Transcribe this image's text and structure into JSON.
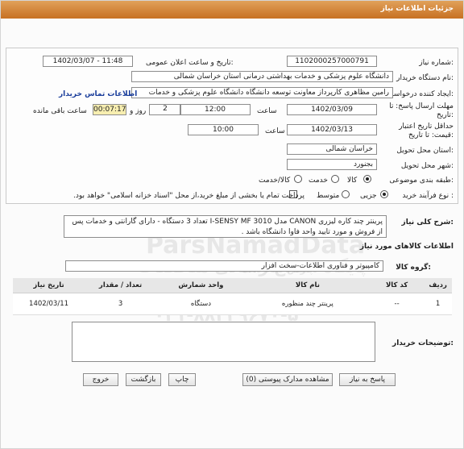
{
  "header": {
    "title": "جزئیات اطلاعات نیاز"
  },
  "form": {
    "need_number_label": "شماره نیاز:",
    "need_number": "1102000257000791",
    "announce_label": "تاریخ و ساعت اعلان عمومی:",
    "announce_value": "1402/03/07 - 11:48",
    "buyer_org_label": "نام دستگاه خریدار:",
    "buyer_org": "دانشگاه علوم پزشکی و خدمات بهداشتی درمانی استان خراسان شمالی",
    "creator_label": "ایجاد کننده درخواست:",
    "creator": "رامین مظاهری کارپرداز معاونت توسعه دانشگاه دانشگاه علوم پزشکی و خدمات",
    "contact_link": "اطلاعات تماس خریدار",
    "deadline_label_line1": "مهلت ارسال پاسخ: تا",
    "deadline_label_line2": "تاریخ:",
    "deadline_date": "1402/03/09",
    "time_label": "ساعت",
    "deadline_time": "12:00",
    "days_count": "2",
    "days_label": "روز و",
    "remaining_timer": "00:07:17",
    "remaining_label": "ساعت باقی مانده",
    "validity_label_line1": "حداقل تاریخ اعتبار",
    "validity_label_line2": "قیمت: تا تاریخ:",
    "validity_date": "1402/03/13",
    "validity_time_label": "ساعت",
    "validity_time": "10:00",
    "province_label": "استان محل تحویل:",
    "province": "خراسان شمالی",
    "city_label": "شهر محل تحویل:",
    "city": "بجنورد",
    "category_label": "طبقه بندی موضوعی:",
    "category_options": [
      "کالا",
      "خدمت",
      "کالا/خدمت"
    ],
    "process_label": "نوع فرآیند خرید :",
    "process_options": [
      "جزیی",
      "متوسط"
    ],
    "payment_note": "پرداخت تمام یا بخشی از مبلغ خرید،از محل \"اسناد خزانه اسلامی\" خواهد بود."
  },
  "summary": {
    "label": "شرح کلی نیاز:",
    "text": "پرینتر چند کاره لیزری CANON  مدل I-SENSY MF 3010 تعداد 3 دستگاه - دارای گارانتی و خدمات پس از فروش و مورد تایید واحد فاوا دانشگاه باشد ."
  },
  "goods": {
    "section_title": "اطلاعات کالاهای مورد نیاز",
    "group_label": "گروه کالا:",
    "group_value": "کامپیوتر و فناوری اطلاعات-سخت افزار",
    "columns": [
      "ردیف",
      "کد کالا",
      "نام کالا",
      "واحد شمارش",
      "تعداد / مقدار",
      "تاریخ نیاز"
    ],
    "rows": [
      {
        "row": "1",
        "code": "--",
        "name": "پرینتر چند منظوره",
        "unit": "دستگاه",
        "qty": "3",
        "date": "1402/03/11"
      }
    ]
  },
  "buyer_notes": {
    "label": "توضیحات خریدار:",
    "text": ""
  },
  "buttons": {
    "reply": "پاسخ به نیاز",
    "view_docs": "مشاهده مدارک پیوستی (0)",
    "print": "چاپ",
    "back": "بازگشت",
    "exit": "خروج"
  },
  "watermark": {
    "line1": "ParsNamadData",
    "line2": "پارس نماد داده",
    "line3": "پایگاه اطلاع رسانی مناقصات",
    "phone": "۰۲۱-۸۸۳۴۹۶۷۰-۵"
  },
  "colors": {
    "header_bar": "#c77022",
    "timer_bg": "#f7eeb0",
    "link": "#1c3f9c"
  }
}
